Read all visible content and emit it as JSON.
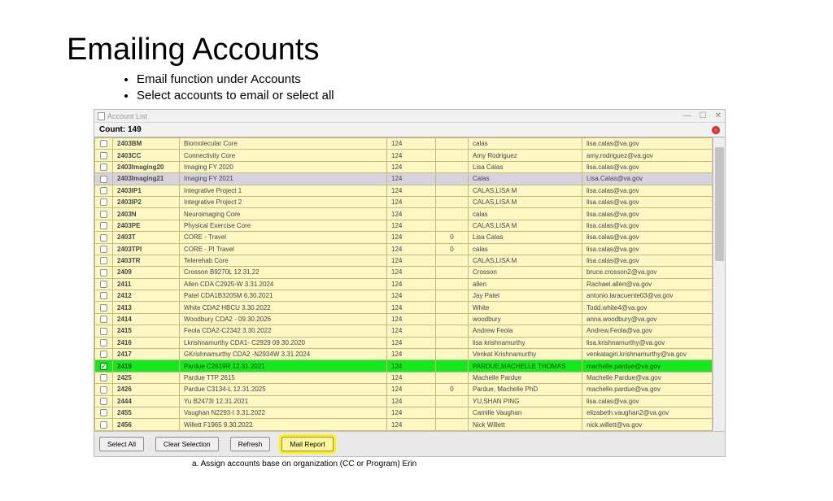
{
  "slide": {
    "title": "Emailing Accounts",
    "bullets": [
      "Email function under Accounts",
      "Select accounts to email or select all"
    ],
    "footer_note": "a.    Assign accounts base on organization (CC or Program) Erin"
  },
  "window": {
    "title": "Account List",
    "count_label": "Count:",
    "count_value": "149",
    "buttons": {
      "select_all": "Select All",
      "clear_selection": "Clear Selection",
      "refresh": "Refresh",
      "mail_report": "Mail Report"
    }
  },
  "rows": [
    {
      "id": "2403BM",
      "name": "Biomolecular Core",
      "num": "124",
      "sub": "",
      "contact": "calas",
      "email": "lisa.calas@va.gov",
      "state": ""
    },
    {
      "id": "2403CC",
      "name": "Connectivity Core",
      "num": "124",
      "sub": "",
      "contact": "Amy Rodriguez",
      "email": "amy.rodriguez@va.gov",
      "state": ""
    },
    {
      "id": "2403Imaging20",
      "name": "Imaging FY 2020",
      "num": "124",
      "sub": "",
      "contact": "Lisa Calas",
      "email": "lisa.calas@va.gov",
      "state": ""
    },
    {
      "id": "2403Imaging21",
      "name": "Imaging FY 2021",
      "num": "124",
      "sub": "",
      "contact": "Calas",
      "email": "Lisa.Calas@va.gov",
      "state": "selected"
    },
    {
      "id": "2403IP1",
      "name": "Integrative Project 1",
      "num": "124",
      "sub": "",
      "contact": "CALAS,LISA M",
      "email": "lisa.calas@va.gov",
      "state": ""
    },
    {
      "id": "2403IP2",
      "name": "Integrative Project 2",
      "num": "124",
      "sub": "",
      "contact": "CALAS,LISA M",
      "email": "lisa.calas@va.gov",
      "state": ""
    },
    {
      "id": "2403N",
      "name": "Neuroimaging Core",
      "num": "124",
      "sub": "",
      "contact": "calas",
      "email": "lisa.calas@va.gov",
      "state": ""
    },
    {
      "id": "2403PE",
      "name": "Physical Exercise Core",
      "num": "124",
      "sub": "",
      "contact": "CALAS,LISA M",
      "email": "lisa.calas@va.gov",
      "state": ""
    },
    {
      "id": "2403T",
      "name": "CORE - Travel",
      "num": "124",
      "sub": "0",
      "contact": "Lisa Calas",
      "email": "lisa.calas@va.gov",
      "state": ""
    },
    {
      "id": "2403TPI",
      "name": "CORE - PI Travel",
      "num": "124",
      "sub": "0",
      "contact": "calas",
      "email": "lisa.calas@va.gov",
      "state": ""
    },
    {
      "id": "2403TR",
      "name": "Telerehab Core",
      "num": "124",
      "sub": "",
      "contact": "CALAS,LISA M",
      "email": "lisa.calas@va.gov",
      "state": ""
    },
    {
      "id": "2409",
      "name": "Crosson B9270L 12.31.22",
      "num": "124",
      "sub": "",
      "contact": "Crosson",
      "email": "bruce.crosson2@va.gov",
      "state": ""
    },
    {
      "id": "2411",
      "name": "Allen CDA C2925-W 3.31.2024",
      "num": "124",
      "sub": "",
      "contact": "allen",
      "email": "Rachael.allen@va.gov",
      "state": ""
    },
    {
      "id": "2412",
      "name": "Patel CDA1B3205M 6.30.2021",
      "num": "124",
      "sub": "",
      "contact": "Jay Patel",
      "email": "antonio.laracuente03@va.gov",
      "state": ""
    },
    {
      "id": "2413",
      "name": "White CDA2 HBCU 3.30.2022",
      "num": "124",
      "sub": "",
      "contact": "White",
      "email": "Todd.white4@va.gov",
      "state": ""
    },
    {
      "id": "2414",
      "name": "Woodbury CDA2 - 09.30.2026",
      "num": "124",
      "sub": "",
      "contact": "woodbury",
      "email": "anna.woodbury@va.gov",
      "state": ""
    },
    {
      "id": "2415",
      "name": "Feola CDA2-C2342 3.30.2022",
      "num": "124",
      "sub": "",
      "contact": "Andrew Feola",
      "email": "Andrew.Feola@va.gov",
      "state": ""
    },
    {
      "id": "2416",
      "name": "Lkrishnamurthy CDA1- C2929 09.30.2020",
      "num": "124",
      "sub": "",
      "contact": "lisa krishnamurthy",
      "email": "lisa.krishnamurthy@va.gov",
      "state": ""
    },
    {
      "id": "2417",
      "name": "GKrishnamurthy CDA2 -N2934W 3.31.2024",
      "num": "124",
      "sub": "",
      "contact": "Venkat Krishnamurthy",
      "email": "venkatagiri.krishnamurthy@va.gov",
      "state": ""
    },
    {
      "id": "2419",
      "name": "Pardue C2619R 12.31.2021",
      "num": "124",
      "sub": "",
      "contact": "PARDUE,MACHELLE THOMAS",
      "email": "machelle.pardue@va.gov",
      "state": "green"
    },
    {
      "id": "2425",
      "name": "Pardue TTP 2615",
      "num": "124",
      "sub": "",
      "contact": "Machelle Pardue",
      "email": "Machelle.Pardue@va.gov",
      "state": ""
    },
    {
      "id": "2426",
      "name": "Pardue C3134-L 12.31.2025",
      "num": "124",
      "sub": "0",
      "contact": "Pardue, Machelle PhD",
      "email": "machelle.pardue@va.gov",
      "state": ""
    },
    {
      "id": "2444",
      "name": "Yu B2473I 12.31.2021",
      "num": "124",
      "sub": "",
      "contact": "YU,SHAN PING",
      "email": "lisa.calas@va.gov",
      "state": ""
    },
    {
      "id": "2455",
      "name": "Vaughan N2293-I 3.31.2022",
      "num": "124",
      "sub": "",
      "contact": "Camille Vaughan",
      "email": "elizabeth.vaughan2@va.gov",
      "state": ""
    },
    {
      "id": "2456",
      "name": "Willett F1965 9.30.2022",
      "num": "124",
      "sub": "",
      "contact": "Nick Willett",
      "email": "nick.willett@va.gov",
      "state": ""
    }
  ]
}
